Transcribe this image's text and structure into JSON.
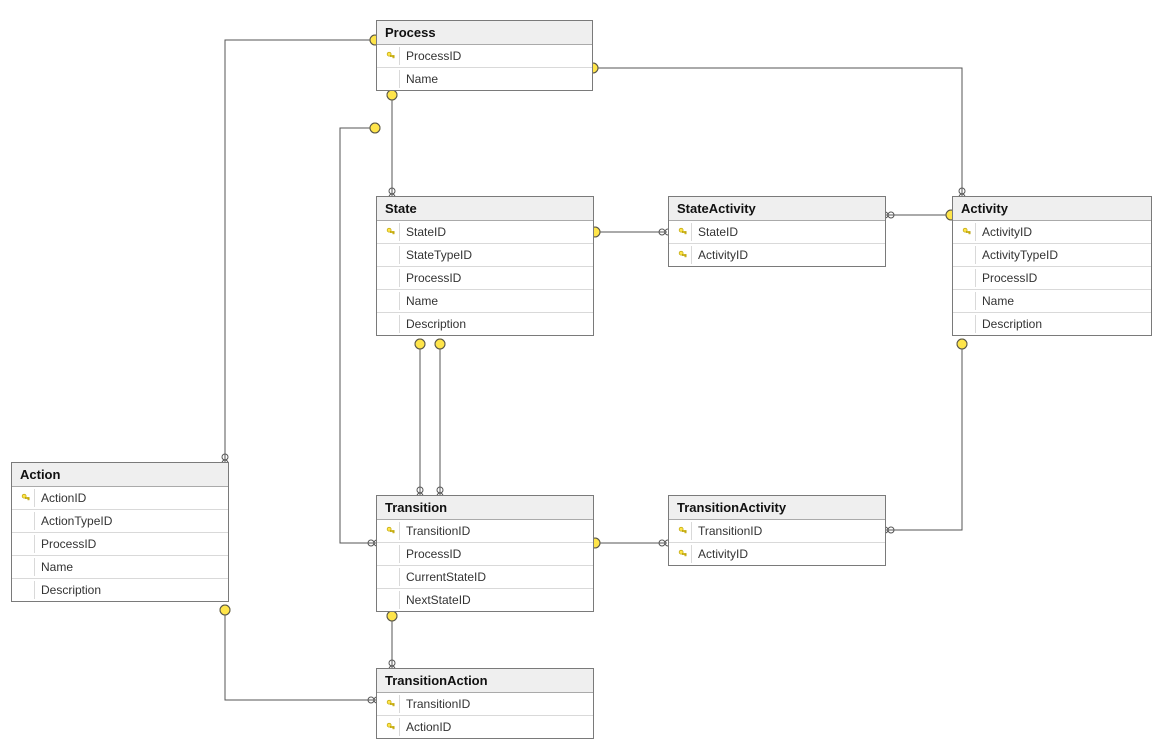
{
  "entities": {
    "process": {
      "title": "Process",
      "columns": [
        {
          "name": "ProcessID",
          "key": true
        },
        {
          "name": "Name",
          "key": false
        }
      ]
    },
    "state": {
      "title": "State",
      "columns": [
        {
          "name": "StateID",
          "key": true
        },
        {
          "name": "StateTypeID",
          "key": false
        },
        {
          "name": "ProcessID",
          "key": false
        },
        {
          "name": "Name",
          "key": false
        },
        {
          "name": "Description",
          "key": false
        }
      ]
    },
    "stateactivity": {
      "title": "StateActivity",
      "columns": [
        {
          "name": "StateID",
          "key": true
        },
        {
          "name": "ActivityID",
          "key": true
        }
      ]
    },
    "activity": {
      "title": "Activity",
      "columns": [
        {
          "name": "ActivityID",
          "key": true
        },
        {
          "name": "ActivityTypeID",
          "key": false
        },
        {
          "name": "ProcessID",
          "key": false
        },
        {
          "name": "Name",
          "key": false
        },
        {
          "name": "Description",
          "key": false
        }
      ]
    },
    "action": {
      "title": "Action",
      "columns": [
        {
          "name": "ActionID",
          "key": true
        },
        {
          "name": "ActionTypeID",
          "key": false
        },
        {
          "name": "ProcessID",
          "key": false
        },
        {
          "name": "Name",
          "key": false
        },
        {
          "name": "Description",
          "key": false
        }
      ]
    },
    "transition": {
      "title": "Transition",
      "columns": [
        {
          "name": "TransitionID",
          "key": true
        },
        {
          "name": "ProcessID",
          "key": false
        },
        {
          "name": "CurrentStateID",
          "key": false
        },
        {
          "name": "NextStateID",
          "key": false
        }
      ]
    },
    "transitionactivity": {
      "title": "TransitionActivity",
      "columns": [
        {
          "name": "TransitionID",
          "key": true
        },
        {
          "name": "ActivityID",
          "key": true
        }
      ]
    },
    "transitionaction": {
      "title": "TransitionAction",
      "columns": [
        {
          "name": "TransitionID",
          "key": true
        },
        {
          "name": "ActionID",
          "key": true
        }
      ]
    }
  },
  "relationships": [
    {
      "from": "Action.ProcessID",
      "to": "Process.ProcessID"
    },
    {
      "from": "State.ProcessID",
      "to": "Process.ProcessID"
    },
    {
      "from": "Transition.ProcessID",
      "to": "Process.ProcessID"
    },
    {
      "from": "Activity.ProcessID",
      "to": "Process.ProcessID"
    },
    {
      "from": "StateActivity.StateID",
      "to": "State.StateID"
    },
    {
      "from": "StateActivity.ActivityID",
      "to": "Activity.ActivityID"
    },
    {
      "from": "Transition.CurrentStateID",
      "to": "State.StateID"
    },
    {
      "from": "Transition.NextStateID",
      "to": "State.StateID"
    },
    {
      "from": "TransitionActivity.TransitionID",
      "to": "Transition.TransitionID"
    },
    {
      "from": "TransitionActivity.ActivityID",
      "to": "Activity.ActivityID"
    },
    {
      "from": "TransitionAction.TransitionID",
      "to": "Transition.TransitionID"
    },
    {
      "from": "TransitionAction.ActionID",
      "to": "Action.ActionID"
    }
  ]
}
